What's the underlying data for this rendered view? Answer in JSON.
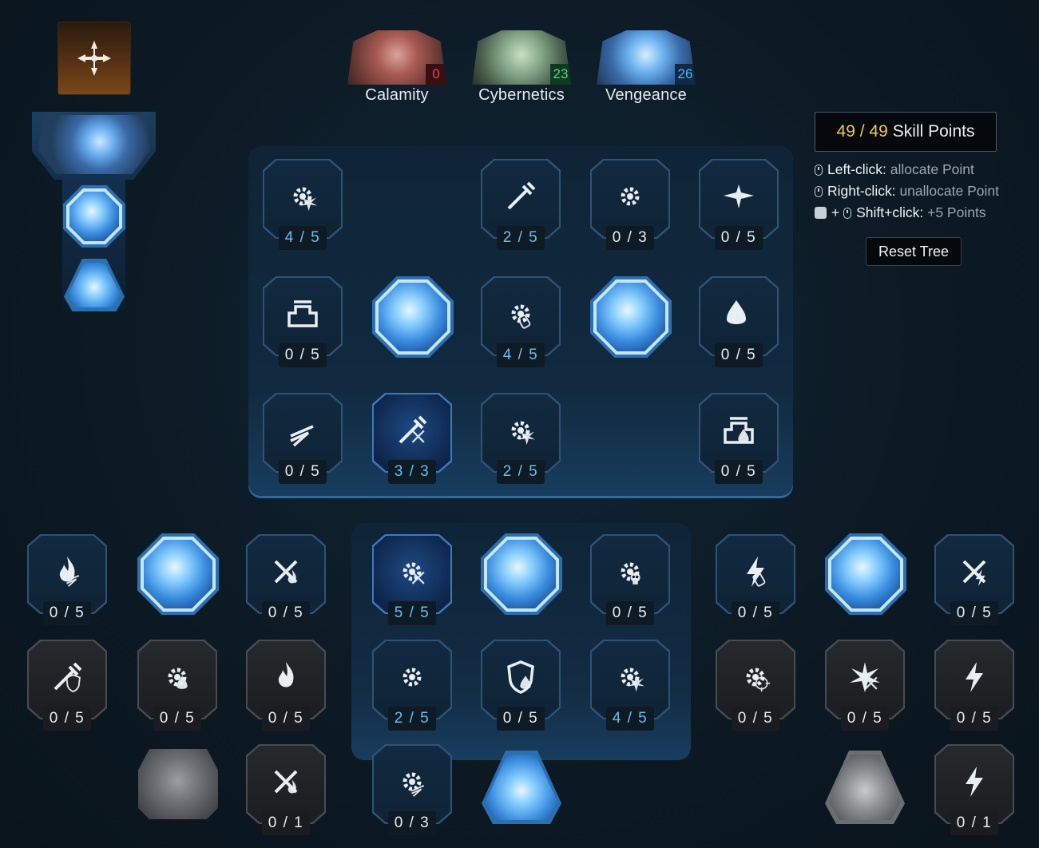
{
  "skill_points": {
    "current": "49",
    "separator": " / ",
    "max": "49",
    "label": "Skill Points"
  },
  "help": [
    {
      "key": "Left-click:",
      "value": "allocate Point"
    },
    {
      "key": "Right-click:",
      "value": "unallocate Point"
    },
    {
      "key": "Shift+click:",
      "value": "+5 Points",
      "prefix": "+"
    }
  ],
  "reset_button": "Reset Tree",
  "trees": [
    {
      "name": "Calamity",
      "count": "0",
      "count_color": "#5a1418",
      "count_text": "#e04848"
    },
    {
      "name": "Cybernetics",
      "count": "23",
      "count_color": "#0f3a22",
      "count_text": "#54d08a"
    },
    {
      "name": "Vengeance",
      "count": "26",
      "count_color": "#0f2a48",
      "count_text": "#5ab4f0"
    }
  ],
  "nodes": [
    {
      "count": "4 / 5",
      "icon": "gear-burst-icon",
      "state": "blue",
      "lit": true
    },
    {
      "count": "2 / 5",
      "icon": "syringe-up-icon",
      "state": "blue",
      "lit": true
    },
    {
      "count": "0 / 3",
      "icon": "gear-icon",
      "state": "blue",
      "lit": false
    },
    {
      "count": "0 / 5",
      "icon": "winged-blade-icon",
      "state": "blue",
      "lit": false
    },
    {
      "count": "0 / 5",
      "icon": "machine-icon",
      "state": "blue",
      "lit": false
    },
    {
      "count": "4 / 5",
      "icon": "canister-gear-icon",
      "state": "blue",
      "lit": true
    },
    {
      "count": "0 / 5",
      "icon": "cross-vial-icon",
      "state": "blue",
      "lit": false
    },
    {
      "count": "0 / 5",
      "icon": "zigzag-dash-icon",
      "state": "blue",
      "lit": false
    },
    {
      "count": "3 / 3",
      "icon": "crossed-syringe-icon",
      "state": "active",
      "lit": true
    },
    {
      "count": "2 / 5",
      "icon": "gear-burst-up-icon",
      "state": "blue",
      "lit": true
    },
    {
      "count": "0 / 5",
      "icon": "machine-vial-icon",
      "state": "blue",
      "lit": false
    },
    {
      "count": "0 / 5",
      "icon": "dash-flame-icon",
      "state": "blue",
      "lit": false
    },
    {
      "count": "0 / 5",
      "icon": "crossed-flame-icon",
      "state": "blue",
      "lit": false
    },
    {
      "count": "5 / 5",
      "icon": "crossed-gear-icon",
      "state": "active",
      "lit": true
    },
    {
      "count": "0 / 5",
      "icon": "skull-gear-icon",
      "state": "blue",
      "lit": false
    },
    {
      "count": "0 / 5",
      "icon": "canister-bolt-icon",
      "state": "blue",
      "lit": false
    },
    {
      "count": "0 / 5",
      "icon": "crossed-bolt-icon",
      "state": "blue",
      "lit": false
    },
    {
      "count": "0 / 5",
      "icon": "shield-syringe-icon",
      "state": "gray",
      "lit": false
    },
    {
      "count": "0 / 5",
      "icon": "droplet-gear-icon",
      "state": "gray",
      "lit": false
    },
    {
      "count": "0 / 5",
      "icon": "flame-icon",
      "state": "gray",
      "lit": false
    },
    {
      "count": "2 / 5",
      "icon": "gear-icon",
      "state": "blue",
      "lit": true
    },
    {
      "count": "0 / 5",
      "icon": "shield-vials-icon",
      "state": "blue",
      "lit": false
    },
    {
      "count": "4 / 5",
      "icon": "gear-cluster-up-icon",
      "state": "blue",
      "lit": true
    },
    {
      "count": "0 / 5",
      "icon": "target-gear-icon",
      "state": "gray",
      "lit": false
    },
    {
      "count": "0 / 5",
      "icon": "crossed-spark-icon",
      "state": "gray",
      "lit": false
    },
    {
      "count": "0 / 5",
      "icon": "bolt-strike-icon",
      "state": "gray",
      "lit": false
    },
    {
      "count": "0 / 1",
      "icon": "crossed-flame-small-icon",
      "state": "gray",
      "lit": false
    },
    {
      "count": "0 / 3",
      "icon": "dash-gear-icon",
      "state": "blue",
      "lit": false
    },
    {
      "count": "0 / 1",
      "icon": "bolt-strike-up-icon",
      "state": "gray",
      "lit": false
    }
  ],
  "colors": {
    "background": "#0c1a24",
    "accent_blue": "#3b7ac0",
    "gold": "#f2c84b",
    "lit_count": "#63c0f0"
  }
}
